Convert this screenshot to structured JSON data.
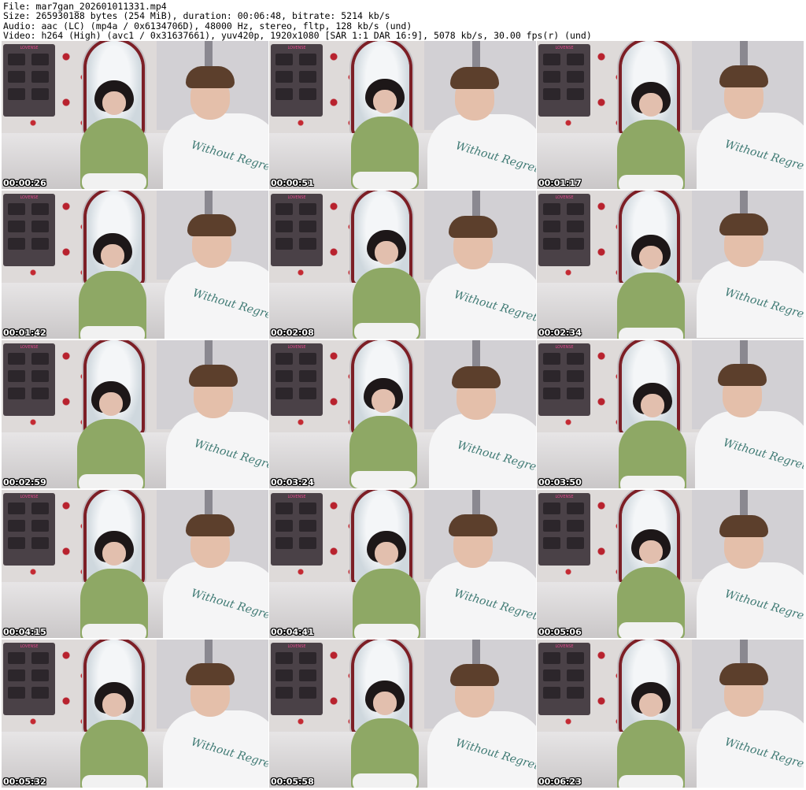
{
  "header": {
    "line1": "File: mar7gan_202601011331.mp4",
    "line2": "Size: 265930188 bytes (254 MiB), duration: 00:06:48, bitrate: 5214 kb/s",
    "line3": "Audio: aac (LC) (mp4a / 0x6134706D), 48000 Hz, stereo, fltp, 128 kb/s (und)",
    "line4": "Video: h264 (High) (avc1 / 0x31637661), yuv420p, 1920x1080 [SAR 1:1 DAR 16:9], 5078 kb/s, 30.00 fps(r) (und)"
  },
  "panel_title": "LOVENSE",
  "shirt_text": "Without Regrets",
  "frames": [
    {
      "timestamp": "00:00:26"
    },
    {
      "timestamp": "00:00:51"
    },
    {
      "timestamp": "00:01:17"
    },
    {
      "timestamp": "00:01:42"
    },
    {
      "timestamp": "00:02:08"
    },
    {
      "timestamp": "00:02:34"
    },
    {
      "timestamp": "00:02:59"
    },
    {
      "timestamp": "00:03:24"
    },
    {
      "timestamp": "00:03:50"
    },
    {
      "timestamp": "00:04:15"
    },
    {
      "timestamp": "00:04:41"
    },
    {
      "timestamp": "00:05:06"
    },
    {
      "timestamp": "00:05:32"
    },
    {
      "timestamp": "00:05:58"
    },
    {
      "timestamp": "00:06:23"
    }
  ],
  "colors": {
    "woman_top": "#8ea865",
    "man_shirt": "#f5f5f6",
    "shirt_print": "#3f7a74",
    "flowers": "#b8222e",
    "panel_accent": "#e2468a"
  }
}
